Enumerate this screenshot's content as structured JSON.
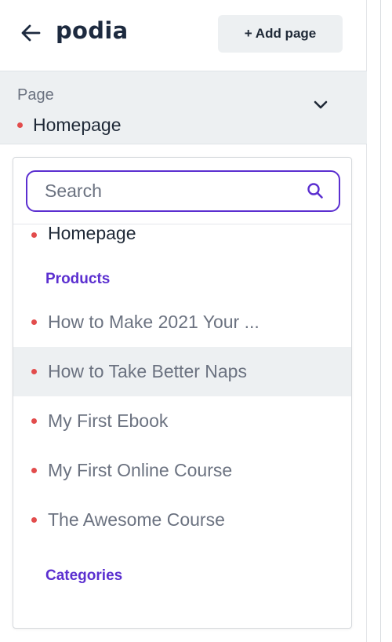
{
  "header": {
    "back_icon": "arrow-left-icon",
    "logo": "podia",
    "add_page_label": "+ Add page"
  },
  "page_select": {
    "label": "Page",
    "value": "Homepage",
    "chevron_icon": "chevron-down-icon"
  },
  "dropdown": {
    "search_placeholder": "Search",
    "search_icon": "search-icon",
    "top_item": "Homepage",
    "products_label": "Products",
    "products": [
      "How to Make 2021 Your ...",
      "How to Take Better Naps",
      "My First Ebook",
      "My First Online Course",
      "The Awesome Course"
    ],
    "categories_label": "Categories"
  },
  "colors": {
    "accent": "#5b2fd0",
    "dot": "#e24c4c",
    "hover_bg": "#edf0f2"
  }
}
